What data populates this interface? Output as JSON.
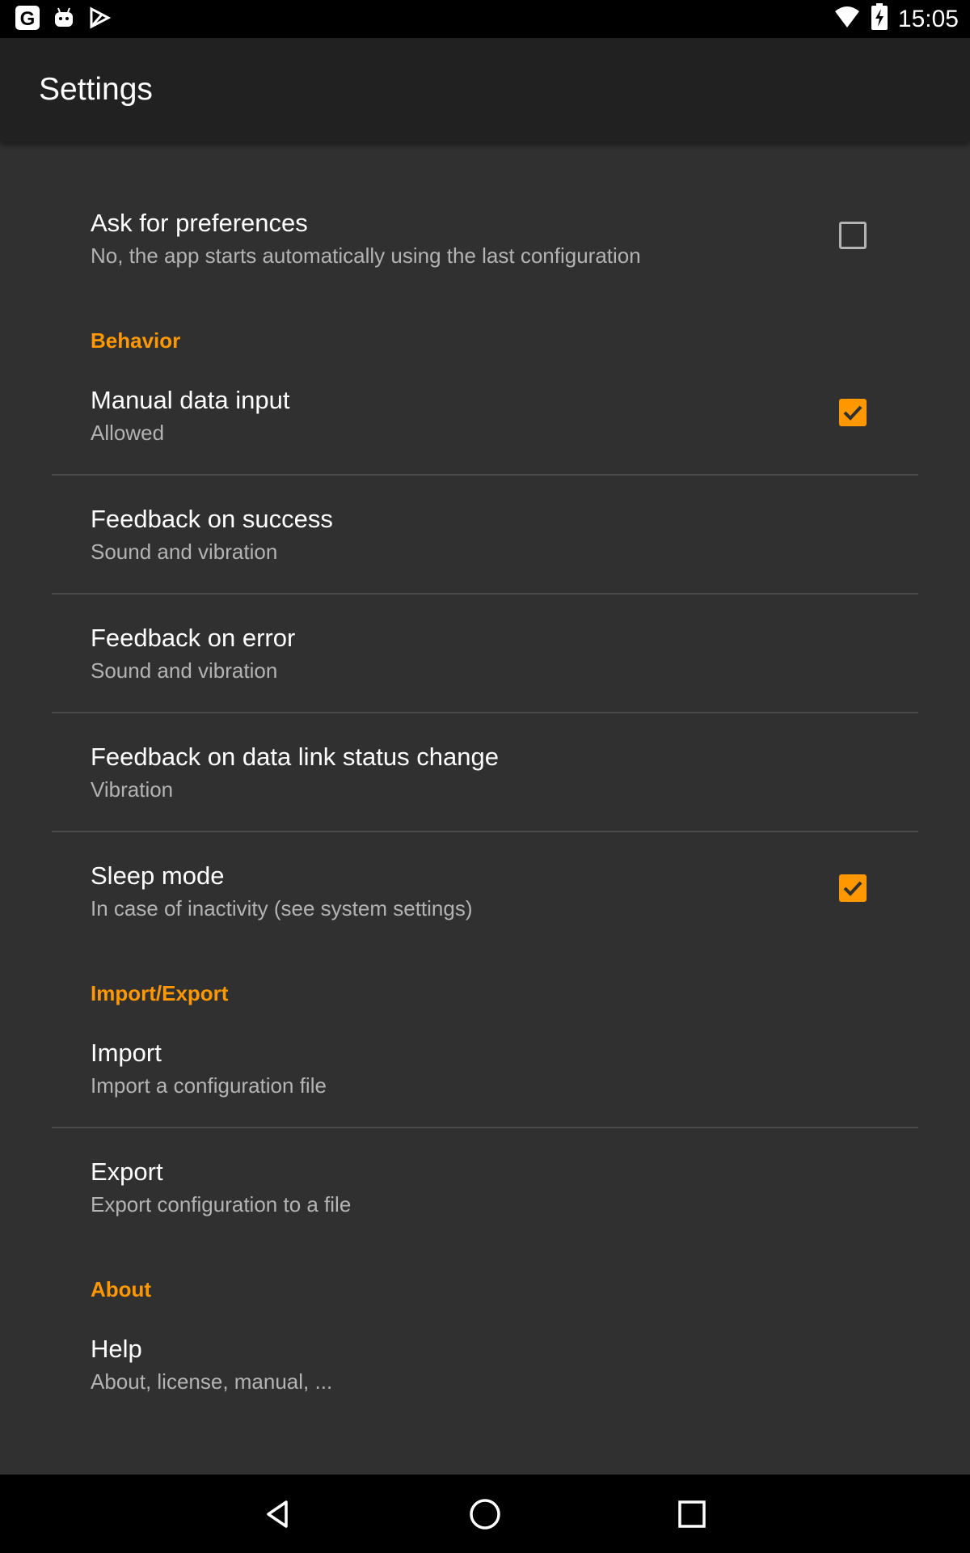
{
  "status_bar": {
    "time": "15:05",
    "icons": [
      "google-icon",
      "android-icon",
      "play-store-icon",
      "wifi-icon",
      "battery-charging-icon"
    ]
  },
  "app_bar": {
    "title": "Settings"
  },
  "preferences": {
    "ask_for_preferences": {
      "title": "Ask for preferences",
      "summary": "No, the app starts automatically using the last configuration",
      "checked": false
    },
    "behavior_header": "Behavior",
    "manual_data_input": {
      "title": "Manual data input",
      "summary": "Allowed",
      "checked": true
    },
    "feedback_success": {
      "title": "Feedback on success",
      "summary": "Sound and vibration"
    },
    "feedback_error": {
      "title": "Feedback on error",
      "summary": "Sound and vibration"
    },
    "feedback_link": {
      "title": "Feedback on data link status change",
      "summary": "Vibration"
    },
    "sleep_mode": {
      "title": "Sleep mode",
      "summary": "In case of inactivity (see system settings)",
      "checked": true
    },
    "import_export_header": "Import/Export",
    "import": {
      "title": "Import",
      "summary": "Import a configuration file"
    },
    "export": {
      "title": "Export",
      "summary": "Export configuration to a file"
    },
    "about_header": "About",
    "help": {
      "title": "Help",
      "summary": "About, license, manual, ..."
    }
  },
  "colors": {
    "accent": "#ff9800",
    "background": "#303030",
    "app_bar": "#212121",
    "text_primary": "#ffffff",
    "text_secondary": "#b3b3b3"
  },
  "nav_bar": {
    "icons": [
      "back-icon",
      "home-icon",
      "recents-icon"
    ]
  }
}
